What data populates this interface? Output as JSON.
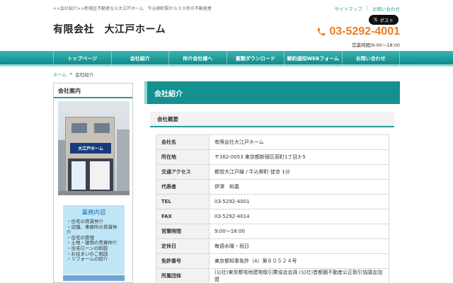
{
  "header": {
    "tagline": "<<会社紹介>>新宿区不動産なら大江戸ホーム　牛込柳町駅から３０秒の不動産屋",
    "links": [
      "サイトマップ",
      "お問い合わせ"
    ],
    "x_post": "ポスト",
    "company_name": "有限会社　大江戸ホーム",
    "phone": "03-5292-4001",
    "hours": "営業時間/9:00～18:00"
  },
  "nav": [
    "トップページ",
    "会社紹介",
    "仲介会社様へ",
    "書類ダウンロード",
    "解約通知WEBフォーム",
    "お問い合わせ"
  ],
  "breadcrumb": {
    "home": "ホーム",
    "sep": "»",
    "current": "会社紹介"
  },
  "sidebar": {
    "title": "会社案内",
    "photo_sign": "大江戸ホーム",
    "business_title": "業務内容",
    "business_items": [
      "住宅の賃貸仲介",
      "店舗、事務所の賃貸仲介",
      "住宅の管理",
      "土地・建物の売買仲介",
      "住宅ローンの斡旋",
      "お住まいのご相談",
      "リフォームの紹介"
    ]
  },
  "main": {
    "title": "会社紹介",
    "section_title": "会社概要",
    "rows": [
      {
        "key": "会社名",
        "value": "有限会社大江戸ホーム"
      },
      {
        "key": "所在地",
        "value": "〒162-0053 東京都新宿区原町1丁目3-5"
      },
      {
        "key": "交通アクセス",
        "value": "都営大江戸線 / 牛込柳町 徒歩 1分"
      },
      {
        "key": "代表者",
        "value": "伊澤　和義"
      },
      {
        "key": "TEL",
        "value": "03-5292-4001"
      },
      {
        "key": "FAX",
        "value": "03-5292-4014"
      },
      {
        "key": "営業時間",
        "value": "9:00～18:00"
      },
      {
        "key": "定休日",
        "value": "毎週水曜・祝日"
      },
      {
        "key": "免許番号",
        "value": "東京都知事免許（4）第８０５２４号"
      },
      {
        "key": "所属団体",
        "value": "(公社)東京都宅地建物取引業協会会員 (公社)首都圏不動産公正取引協議会加盟"
      }
    ]
  },
  "colors": {
    "accent": "#139191",
    "phone": "#f07a1a",
    "business_bg": "#bfe6f7"
  }
}
